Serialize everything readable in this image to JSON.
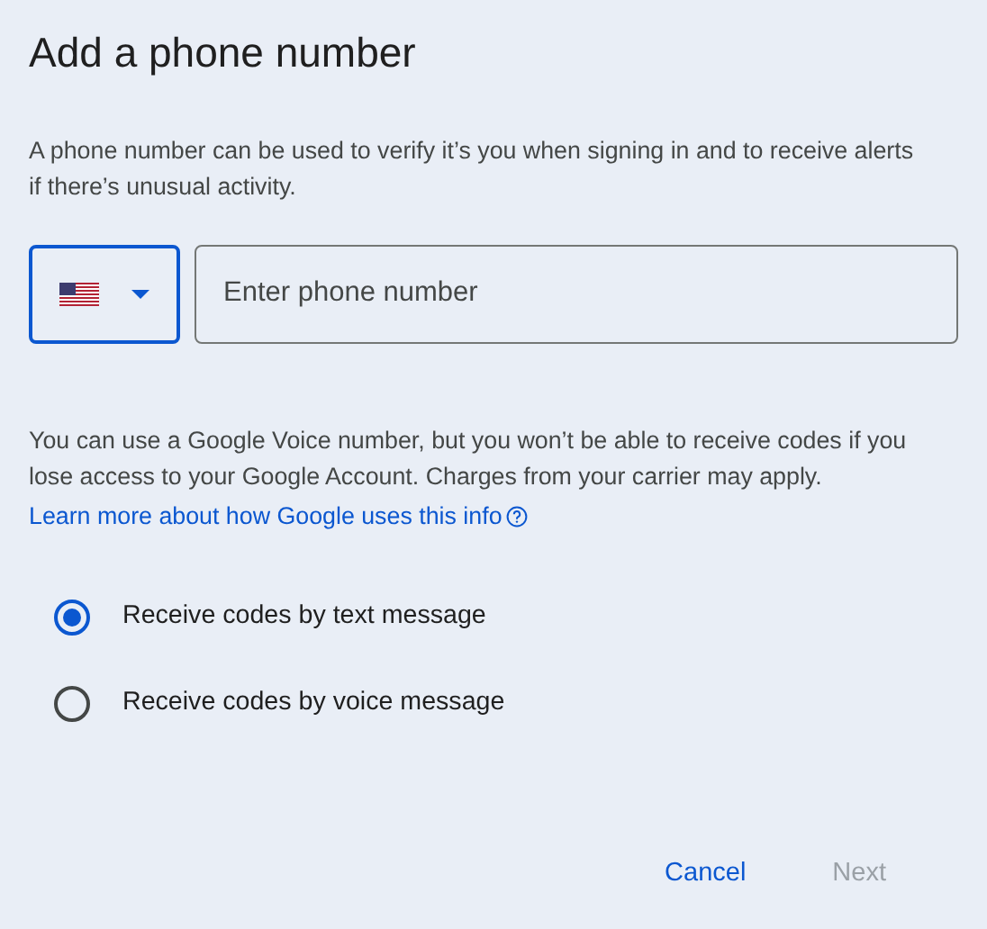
{
  "title": "Add a phone number",
  "intro": "A phone number can be used to verify it’s you when signing in and to receive alerts if there’s unusual activity.",
  "country_picker": {
    "focused": true
  },
  "phone_field": {
    "placeholder": "Enter phone number"
  },
  "note": "You can use a Google Voice number, but you won’t be able to receive codes if you lose access to your Google Account. Charges from your carrier may apply.",
  "learn_more_link": "Learn more about how Google uses this info",
  "options": [
    {
      "label": "Receive codes by text message",
      "selected": true
    },
    {
      "label": "Receive codes by voice message",
      "selected": false
    }
  ],
  "buttons": [
    {
      "label": "Cancel",
      "disabled": false
    },
    {
      "label": "Next",
      "disabled": true
    }
  ]
}
